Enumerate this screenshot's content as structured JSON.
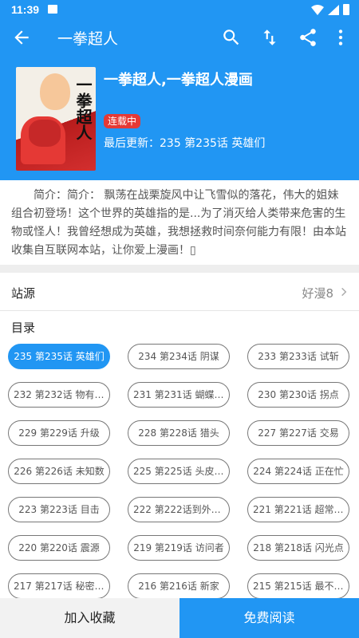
{
  "status_bar": {
    "time": "11:39"
  },
  "app_bar": {
    "title": "一拳超人"
  },
  "comic": {
    "title": "一拳超人,一拳超人漫画",
    "cover_text": "一拳超人",
    "status_badge": "连载中",
    "last_update": "最后更新：235 第235话 英雄们"
  },
  "intro": "简介：简介： 飘荡在战栗旋风中让飞雪似的落花，伟大的姐妹组合初登场！这个世界的英雄指的是...为了消灭给人类带来危害的生物或怪人！我曾经想成为英雄，我想拯救时间奈何能力有限！由本站收集自互联网本站，让你爱上漫画！▯",
  "source": {
    "label": "站源",
    "value": "好漫8"
  },
  "toc_label": "目录",
  "chapters": [
    "235 第235话 英雄们",
    "234 第234话 阴谋",
    "233 第233话 试斩",
    "232 第232话 物有所…",
    "231 第231话 蝴蝶与…",
    "230 第230话 拐点",
    "229 第229话 升级",
    "228 第228话 猎头",
    "227 第227话 交易",
    "226 第226话 未知数",
    "225 第225话 头皮与…",
    "224 第224话 正在忙",
    "223 第223话 目击",
    "222 第222话到外面…",
    "221 第221话 超常与…",
    "220 第220话 震源",
    "219 第219话 访问者",
    "218 第218话 闪光点",
    "217 第217话 秘密情…",
    "216 第216话 新家",
    "215 第215话 最不想…"
  ],
  "bottom": {
    "favorite": "加入收藏",
    "read": "免费阅读"
  },
  "colors": {
    "primary": "#2196F3",
    "badge": "#e53935"
  }
}
